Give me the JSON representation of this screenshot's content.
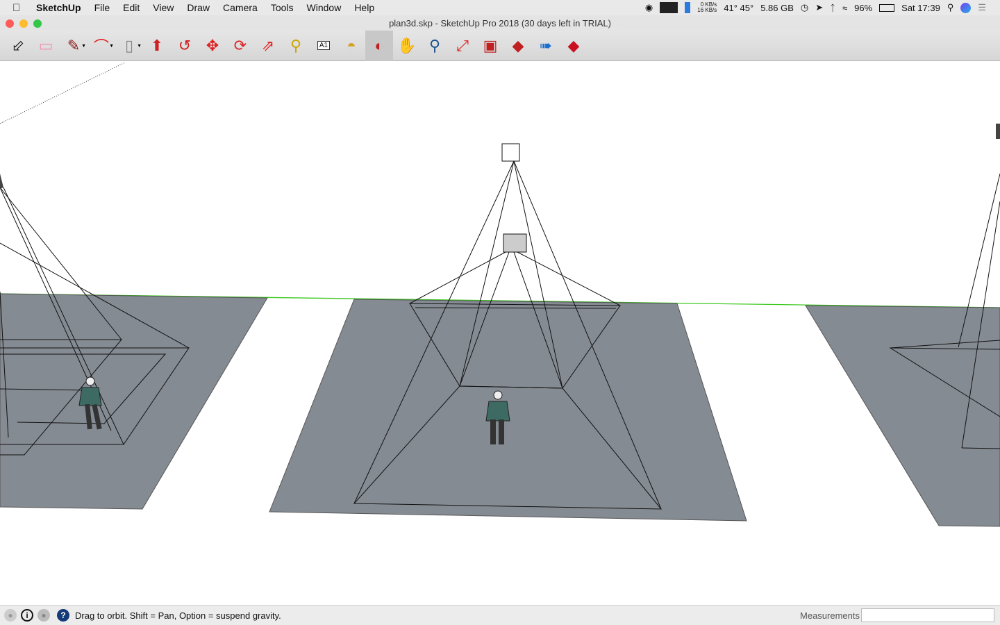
{
  "menubar": {
    "app": "SketchUp",
    "items": [
      "File",
      "Edit",
      "View",
      "Draw",
      "Camera",
      "Tools",
      "Window",
      "Help"
    ],
    "status": {
      "net_up": "0 KB/s",
      "net_down": "16 KB/s",
      "temps": "41° 45°",
      "memory": "5.86 GB",
      "battery": "96%",
      "clock": "Sat 17:39"
    }
  },
  "window": {
    "title": "plan3d.skp - SketchUp Pro 2018 (30 days left in TRIAL)"
  },
  "toolbar": {
    "tools": [
      {
        "name": "select",
        "icon": "arrow-cursor-icon"
      },
      {
        "name": "eraser",
        "icon": "eraser-icon"
      },
      {
        "name": "line",
        "icon": "pencil-icon",
        "dropdown": true
      },
      {
        "name": "arc",
        "icon": "arc-icon",
        "dropdown": true
      },
      {
        "name": "rectangle",
        "icon": "rectangle-icon",
        "dropdown": true
      },
      {
        "name": "push-pull",
        "icon": "push-pull-icon"
      },
      {
        "name": "offset",
        "icon": "offset-icon"
      },
      {
        "name": "move",
        "icon": "move-icon"
      },
      {
        "name": "rotate",
        "icon": "rotate-icon"
      },
      {
        "name": "scale",
        "icon": "scale-icon"
      },
      {
        "name": "tape-measure",
        "icon": "tape-measure-icon"
      },
      {
        "name": "text",
        "icon": "text-icon"
      },
      {
        "name": "paint-bucket",
        "icon": "paint-bucket-icon"
      },
      {
        "name": "orbit",
        "icon": "orbit-icon",
        "active": true
      },
      {
        "name": "pan",
        "icon": "hand-icon"
      },
      {
        "name": "zoom",
        "icon": "magnifier-icon"
      },
      {
        "name": "zoom-extents",
        "icon": "zoom-extents-icon"
      },
      {
        "name": "3d-warehouse",
        "icon": "warehouse-icon"
      },
      {
        "name": "extension-warehouse",
        "icon": "extension-icon"
      },
      {
        "name": "send-to-layout",
        "icon": "layout-icon"
      },
      {
        "name": "extension-manager",
        "icon": "ruby-icon"
      }
    ]
  },
  "statusbar": {
    "hint": "Drag to orbit. Shift = Pan, Option = suspend gravity.",
    "measurements_label": "Measurements",
    "measurements_value": ""
  },
  "colors": {
    "ground": "#858b93",
    "horizon": "#3cc81e",
    "accent": "#e02020"
  }
}
